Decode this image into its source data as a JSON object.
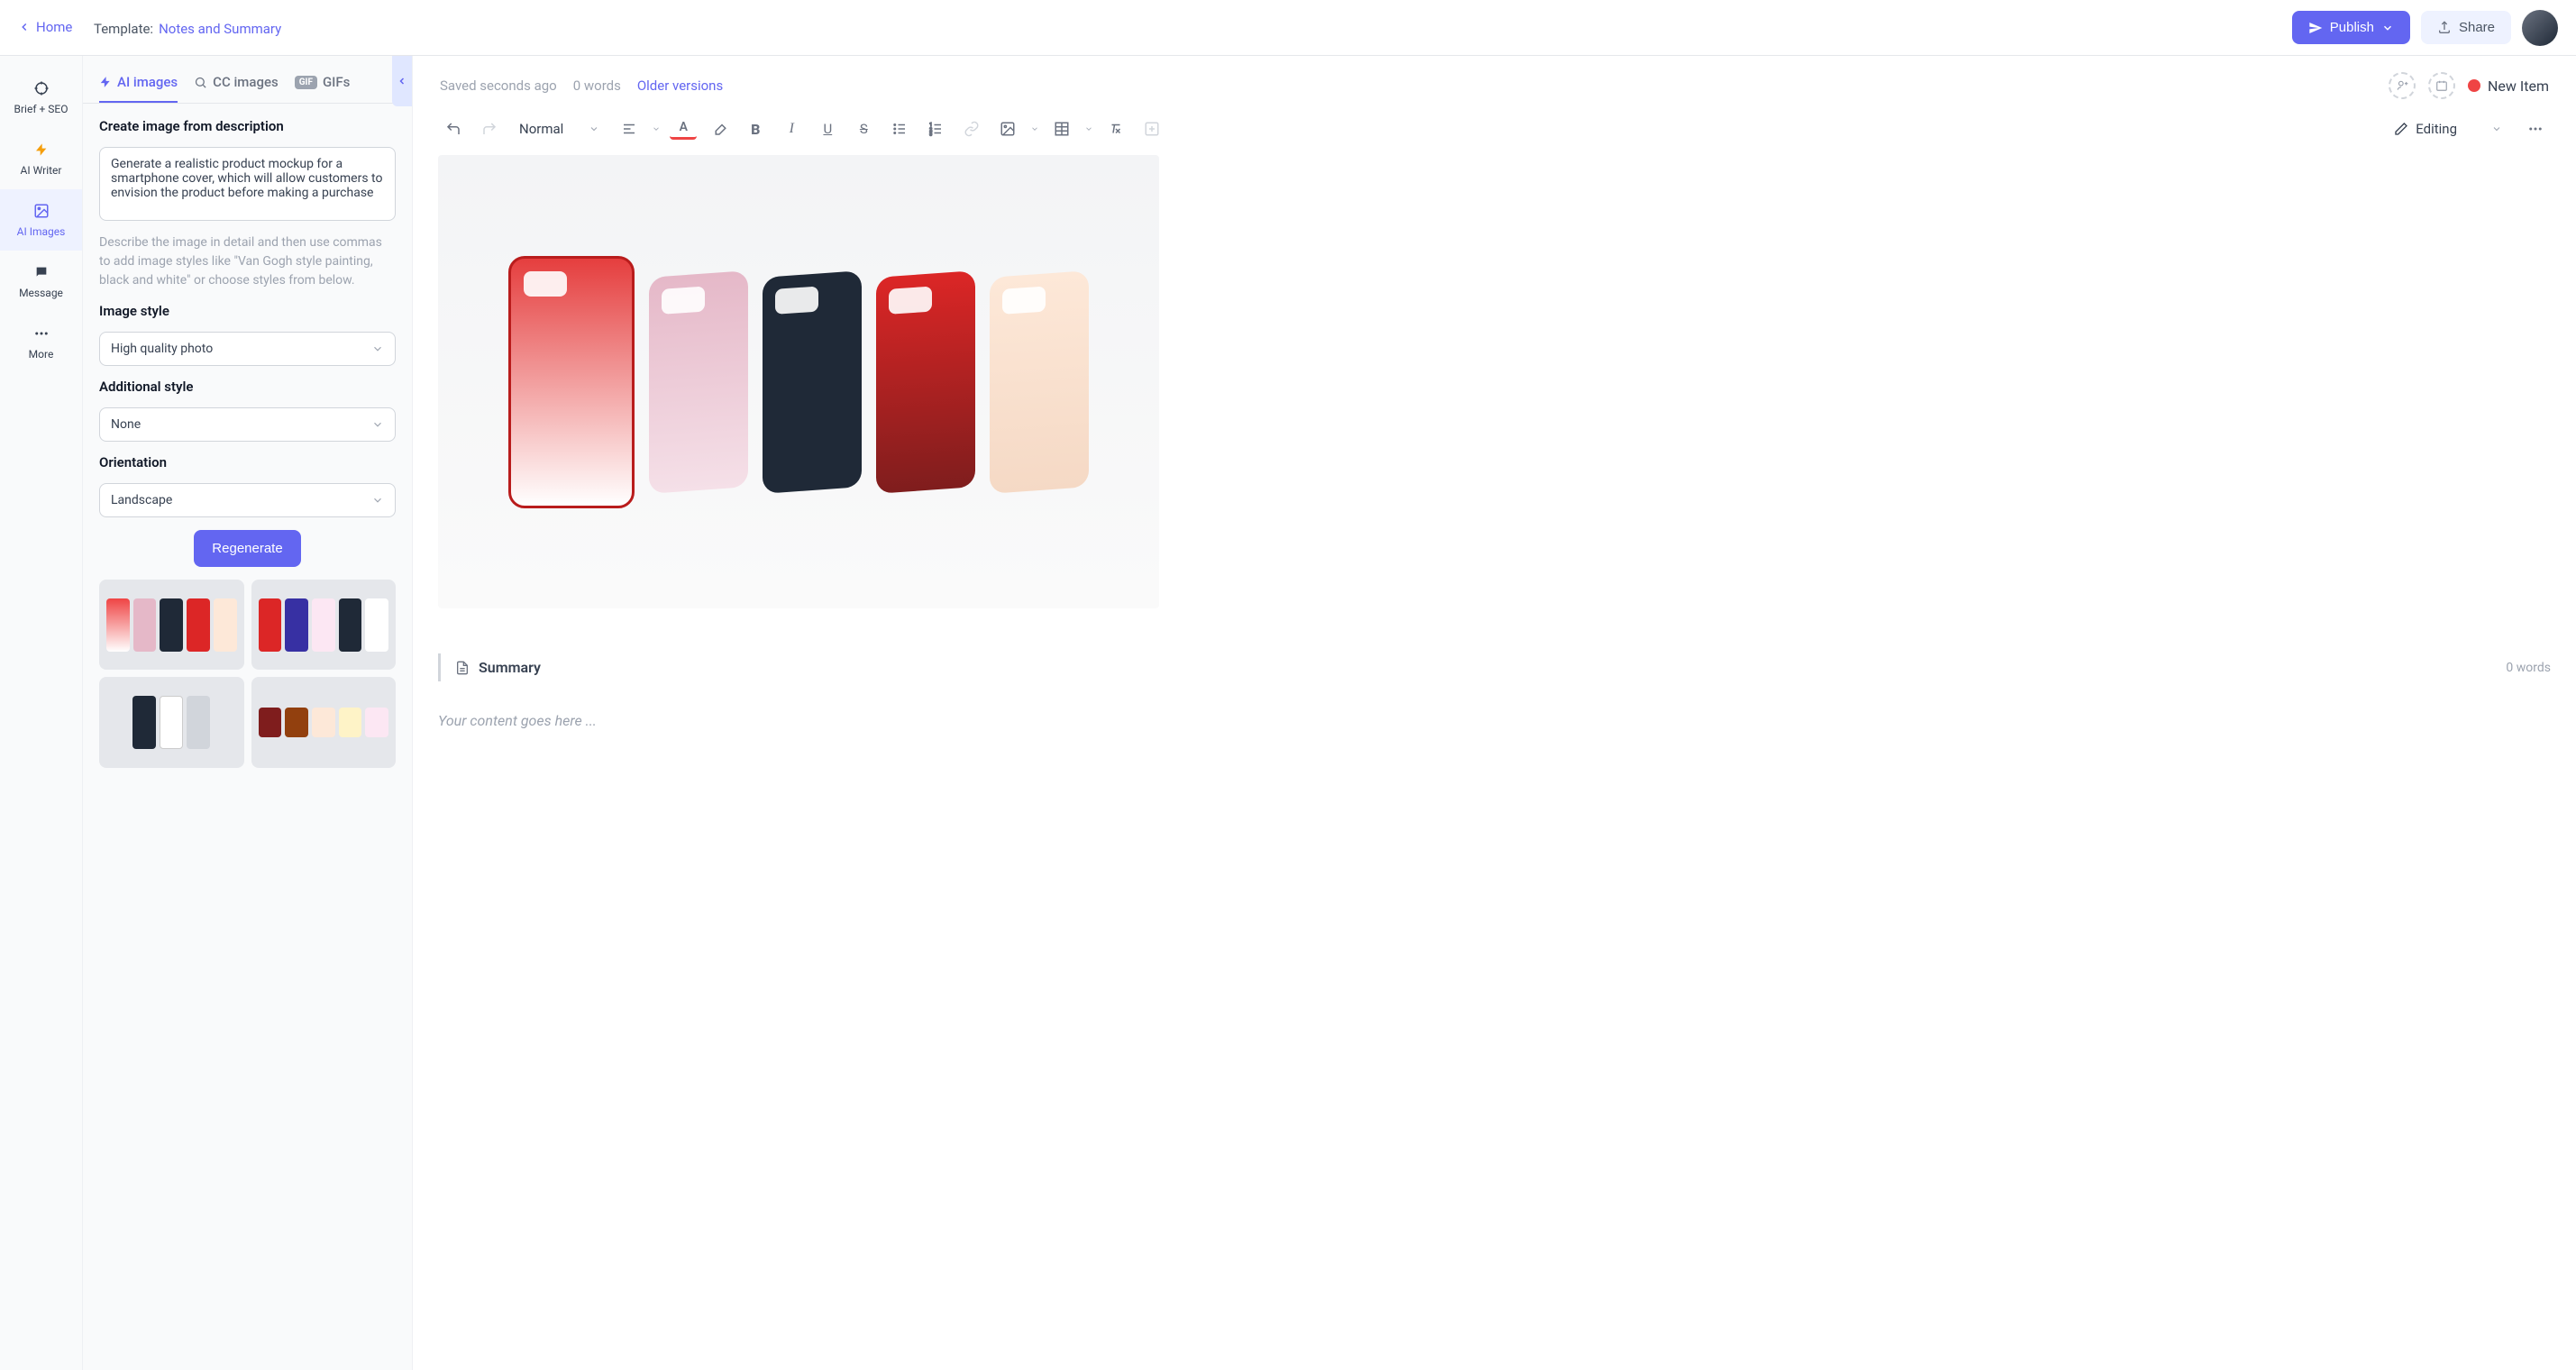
{
  "header": {
    "home": "Home",
    "template_label": "Template:",
    "template_name": "Notes and Summary",
    "publish": "Publish",
    "share": "Share"
  },
  "rail": {
    "items": [
      {
        "label": "Brief + SEO"
      },
      {
        "label": "AI Writer"
      },
      {
        "label": "AI Images"
      },
      {
        "label": "Message"
      },
      {
        "label": "More"
      }
    ]
  },
  "tabs": {
    "ai_images": "AI images",
    "cc_images": "CC images",
    "gifs": "GIFs",
    "gif_badge": "GIF"
  },
  "panel": {
    "create_title": "Create image from description",
    "description_value": "Generate a realistic product mockup for a smartphone cover, which will allow customers to envision the product before making a purchase",
    "hint": "Describe the image in detail and then use commas to add image styles like \"Van Gogh style painting, black and white\" or choose styles from below.",
    "image_style_label": "Image style",
    "image_style_value": "High quality photo",
    "additional_style_label": "Additional style",
    "additional_style_value": "None",
    "orientation_label": "Orientation",
    "orientation_value": "Landscape",
    "regenerate": "Regenerate"
  },
  "content": {
    "saved": "Saved seconds ago",
    "words": "0 words",
    "older_versions": "Older versions",
    "new_item": "New Item",
    "block_format": "Normal",
    "editing_mode": "Editing",
    "summary_title": "Summary",
    "summary_words": "0 words",
    "placeholder": "Your content goes here ..."
  }
}
